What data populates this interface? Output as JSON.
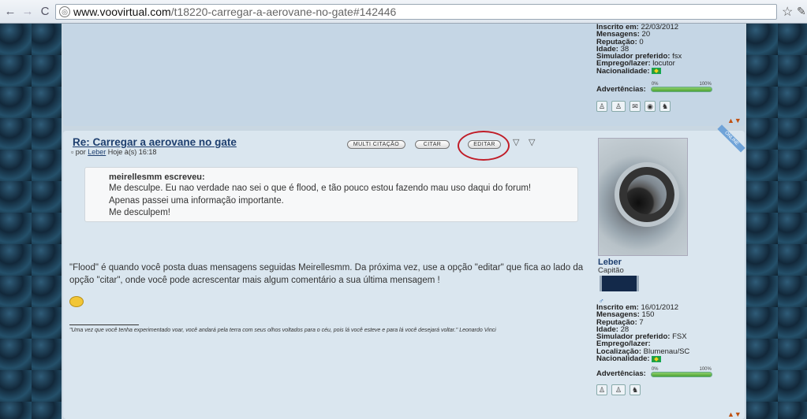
{
  "browser": {
    "url_host": "www.voovirtual.com",
    "url_path": "/t18220-carregar-a-aerovane-no-gate#142446"
  },
  "post1_profile": {
    "inscrito_label": "Inscrito em:",
    "inscrito": "22/03/2012",
    "mensagens_label": "Mensagens:",
    "mensagens": "20",
    "reputacao_label": "Reputação:",
    "reputacao": "0",
    "idade_label": "Idade:",
    "idade": "38",
    "simulador_label": "Simulador preferido:",
    "simulador": "fsx",
    "emprego_label": "Emprego/lazer:",
    "emprego": "locutor",
    "nacionalidade_label": "Nacionalidade:",
    "advertencias_label": "Advertências:",
    "warn_min": "0%",
    "warn_max": "100%",
    "warn_level": 1.0
  },
  "post2": {
    "title": "Re: Carregar a aerovane no gate",
    "meta_prefix": "por",
    "author": "Leber",
    "meta_time": "Hoje à(s) 16:18",
    "buttons": {
      "multi": "MULTI CITAÇÃO",
      "citar": "CITAR",
      "editar": "EDITAR"
    },
    "quote_author": "meirellesmm escreveu:",
    "quote_text": "Me desculpe. Eu nao verdade nao sei o que é flood, e tão pouco estou fazendo mau uso daqui do forum!\nApenas passei uma informação importante.\nMe desculpem!",
    "body": "\"Flood\" é quando você posta duas mensagens seguidas Meirellesmm. Da próxima vez, use a opção \"editar\" que fica ao lado da opção \"citar\", onde você pode acrescentar mais algum comentário a sua última mensagem !",
    "signature": "\"Uma vez que você tenha experimentado voar, você andará pela terra com seus olhos voltados para o céu, pois lá você esteve e para lá você desejará voltar.\" Leonardo Vinci",
    "online_badge": "ONLINE"
  },
  "post2_profile": {
    "username": "Leber",
    "rank": "Capitão",
    "inscrito_label": "Inscrito em:",
    "inscrito": "16/01/2012",
    "mensagens_label": "Mensagens:",
    "mensagens": "150",
    "reputacao_label": "Reputação:",
    "reputacao": "7",
    "idade_label": "Idade:",
    "idade": "28",
    "simulador_label": "Simulador preferido:",
    "simulador": "FSX",
    "emprego_label": "Emprego/lazer:",
    "localizacao_label": "Localização:",
    "localizacao": "Blumenau/SC",
    "nacionalidade_label": "Nacionalidade:",
    "advertencias_label": "Advertências:",
    "warn_min": "0%",
    "warn_max": "100%",
    "warn_level": 1.0
  }
}
